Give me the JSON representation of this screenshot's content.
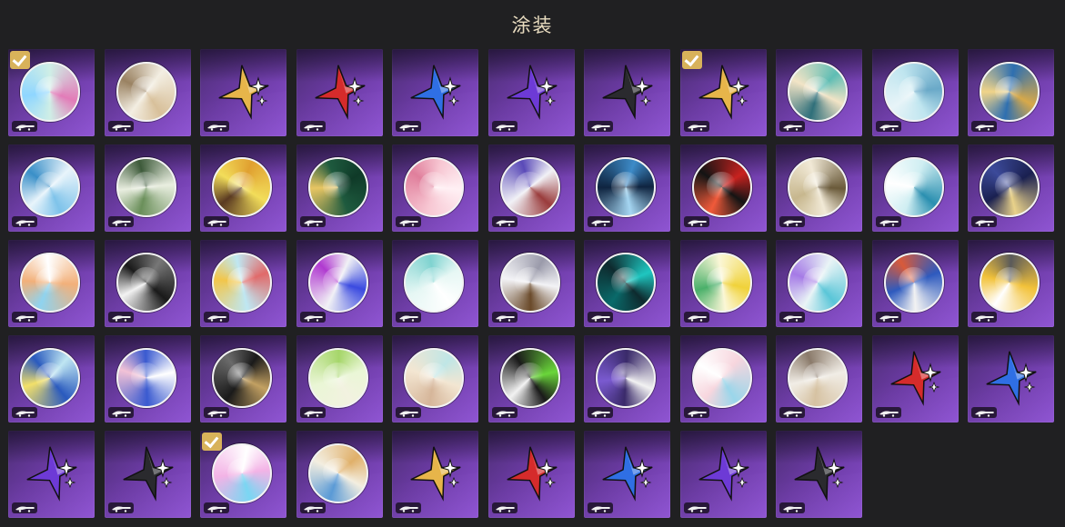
{
  "header": {
    "title": "涂装"
  },
  "skins": [
    {
      "type": "disc",
      "colors": [
        "#cfeee6",
        "#e27bb8",
        "#8fd6ff"
      ],
      "selected": true
    },
    {
      "type": "disc",
      "colors": [
        "#f3eee2",
        "#d8c09a",
        "#9a8262"
      ],
      "selected": false
    },
    {
      "type": "star",
      "colors": [
        "#e7b54a"
      ],
      "selected": false
    },
    {
      "type": "star",
      "colors": [
        "#d52b2b"
      ],
      "selected": false
    },
    {
      "type": "star",
      "colors": [
        "#2f6fe4"
      ],
      "selected": false
    },
    {
      "type": "star",
      "colors": [
        "#6d3ad6"
      ],
      "selected": false
    },
    {
      "type": "star",
      "colors": [
        "#2a2a2e"
      ],
      "selected": false
    },
    {
      "type": "star",
      "colors": [
        "#e7b54a"
      ],
      "selected": true
    },
    {
      "type": "disc",
      "colors": [
        "#f2e4c6",
        "#5fbdb4",
        "#2f6f7a"
      ],
      "selected": false
    },
    {
      "type": "disc",
      "colors": [
        "#bfe5ef",
        "#6aa9c8",
        "#e7f4f8"
      ],
      "selected": false
    },
    {
      "type": "disc",
      "colors": [
        "#2e6fb0",
        "#d7a94a",
        "#f0d48a"
      ],
      "selected": false
    },
    {
      "type": "disc",
      "colors": [
        "#e8f4fb",
        "#7ec3ea",
        "#3a8fc8"
      ],
      "selected": false
    },
    {
      "type": "disc",
      "colors": [
        "#e9eee0",
        "#6a8f5a",
        "#3d5a3a"
      ],
      "selected": false
    },
    {
      "type": "disc",
      "colors": [
        "#f2dd5a",
        "#5a3a22",
        "#e0a030"
      ],
      "selected": false
    },
    {
      "type": "disc",
      "colors": [
        "#1e5a3e",
        "#e7c563",
        "#0f3a28"
      ],
      "selected": false
    },
    {
      "type": "disc",
      "colors": [
        "#f7c6d2",
        "#e07f9c",
        "#fff0f4"
      ],
      "selected": false
    },
    {
      "type": "disc",
      "colors": [
        "#f1f1f6",
        "#5a4ab8",
        "#9a3c3c"
      ],
      "selected": false
    },
    {
      "type": "disc",
      "colors": [
        "#0f2440",
        "#3d8bc8",
        "#a5d6f2"
      ],
      "selected": false
    },
    {
      "type": "disc",
      "colors": [
        "#141414",
        "#c8221f",
        "#f05a3a"
      ],
      "selected": false
    },
    {
      "type": "disc",
      "colors": [
        "#f1e9d6",
        "#6a5a3a",
        "#c7b78e"
      ],
      "selected": false
    },
    {
      "type": "disc",
      "colors": [
        "#cfeef2",
        "#2a8fb0",
        "#ffffff"
      ],
      "selected": false
    },
    {
      "type": "disc",
      "colors": [
        "#1a2050",
        "#e9d28a",
        "#3c4a9a"
      ],
      "selected": false
    },
    {
      "type": "disc",
      "colors": [
        "#f2b07a",
        "#8fd3ef",
        "#ffffff"
      ],
      "selected": false
    },
    {
      "type": "disc",
      "colors": [
        "#1a1a1a",
        "#f2f2f2",
        "#777777"
      ],
      "selected": false
    },
    {
      "type": "disc",
      "colors": [
        "#bfe7f2",
        "#f2c64a",
        "#e06a6a"
      ],
      "selected": false
    },
    {
      "type": "disc",
      "colors": [
        "#f1f1f5",
        "#b03ad0",
        "#3a4ae0"
      ],
      "selected": false
    },
    {
      "type": "disc",
      "colors": [
        "#e6f7f4",
        "#7fd3d0",
        "#ffffff"
      ],
      "selected": false
    },
    {
      "type": "disc",
      "colors": [
        "#f3f3f6",
        "#9a9aaa",
        "#6a4a2a"
      ],
      "selected": false
    },
    {
      "type": "disc",
      "colors": [
        "#0e2a2e",
        "#1fc6c0",
        "#0a6a6a"
      ],
      "selected": false
    },
    {
      "type": "disc",
      "colors": [
        "#fbf7d6",
        "#f0d23a",
        "#4ab06a"
      ],
      "selected": false
    },
    {
      "type": "disc",
      "colors": [
        "#e9f4f6",
        "#5ac6d8",
        "#a57ae6"
      ],
      "selected": false
    },
    {
      "type": "disc",
      "colors": [
        "#2e5abe",
        "#f2f2f2",
        "#d85a3a"
      ],
      "selected": false
    },
    {
      "type": "disc",
      "colors": [
        "#f2c23a",
        "#ffffff",
        "#5a5a5a"
      ],
      "selected": false
    },
    {
      "type": "disc",
      "colors": [
        "#2a5abe",
        "#f2e06a",
        "#bfe6f2"
      ],
      "selected": false
    },
    {
      "type": "disc",
      "colors": [
        "#3a5ad0",
        "#f2c2d6",
        "#ffffff"
      ],
      "selected": false
    },
    {
      "type": "disc",
      "colors": [
        "#1a1a1a",
        "#6a6a6a",
        "#c2a062"
      ],
      "selected": false
    },
    {
      "type": "disc",
      "colors": [
        "#eaf6d6",
        "#a6d66a",
        "#f2f2e0"
      ],
      "selected": false
    },
    {
      "type": "disc",
      "colors": [
        "#f3e6d2",
        "#bfe6e6",
        "#d6b69a"
      ],
      "selected": false
    },
    {
      "type": "disc",
      "colors": [
        "#1a1a1a",
        "#6ad63a",
        "#f2f2f2"
      ],
      "selected": false
    },
    {
      "type": "disc",
      "colors": [
        "#3a2a6a",
        "#f2f2f2",
        "#7a5ad0"
      ],
      "selected": false
    },
    {
      "type": "disc",
      "colors": [
        "#f7d6de",
        "#9ad6ea",
        "#ffffff"
      ],
      "selected": false
    },
    {
      "type": "disc",
      "colors": [
        "#f1ede6",
        "#d6c2a2",
        "#8a7a6a"
      ],
      "selected": false
    },
    {
      "type": "star",
      "colors": [
        "#d52b2b"
      ],
      "selected": false
    },
    {
      "type": "star",
      "colors": [
        "#2f6fe4"
      ],
      "selected": false
    },
    {
      "type": "star",
      "colors": [
        "#6d3ad6"
      ],
      "selected": false
    },
    {
      "type": "star",
      "colors": [
        "#2a2a2e"
      ],
      "selected": false
    },
    {
      "type": "disc",
      "colors": [
        "#f3b3e6",
        "#ffffff",
        "#7ad6f2"
      ],
      "selected": true
    },
    {
      "type": "disc",
      "colors": [
        "#f3eee0",
        "#e0b06a",
        "#5a9ad6"
      ],
      "selected": false
    },
    {
      "type": "star",
      "colors": [
        "#e7b54a"
      ],
      "selected": false
    },
    {
      "type": "star",
      "colors": [
        "#d52b2b"
      ],
      "selected": false
    },
    {
      "type": "star",
      "colors": [
        "#2f6fe4"
      ],
      "selected": false
    },
    {
      "type": "star",
      "colors": [
        "#6d3ad6"
      ],
      "selected": false
    },
    {
      "type": "star",
      "colors": [
        "#2a2a2e"
      ],
      "selected": false
    }
  ]
}
